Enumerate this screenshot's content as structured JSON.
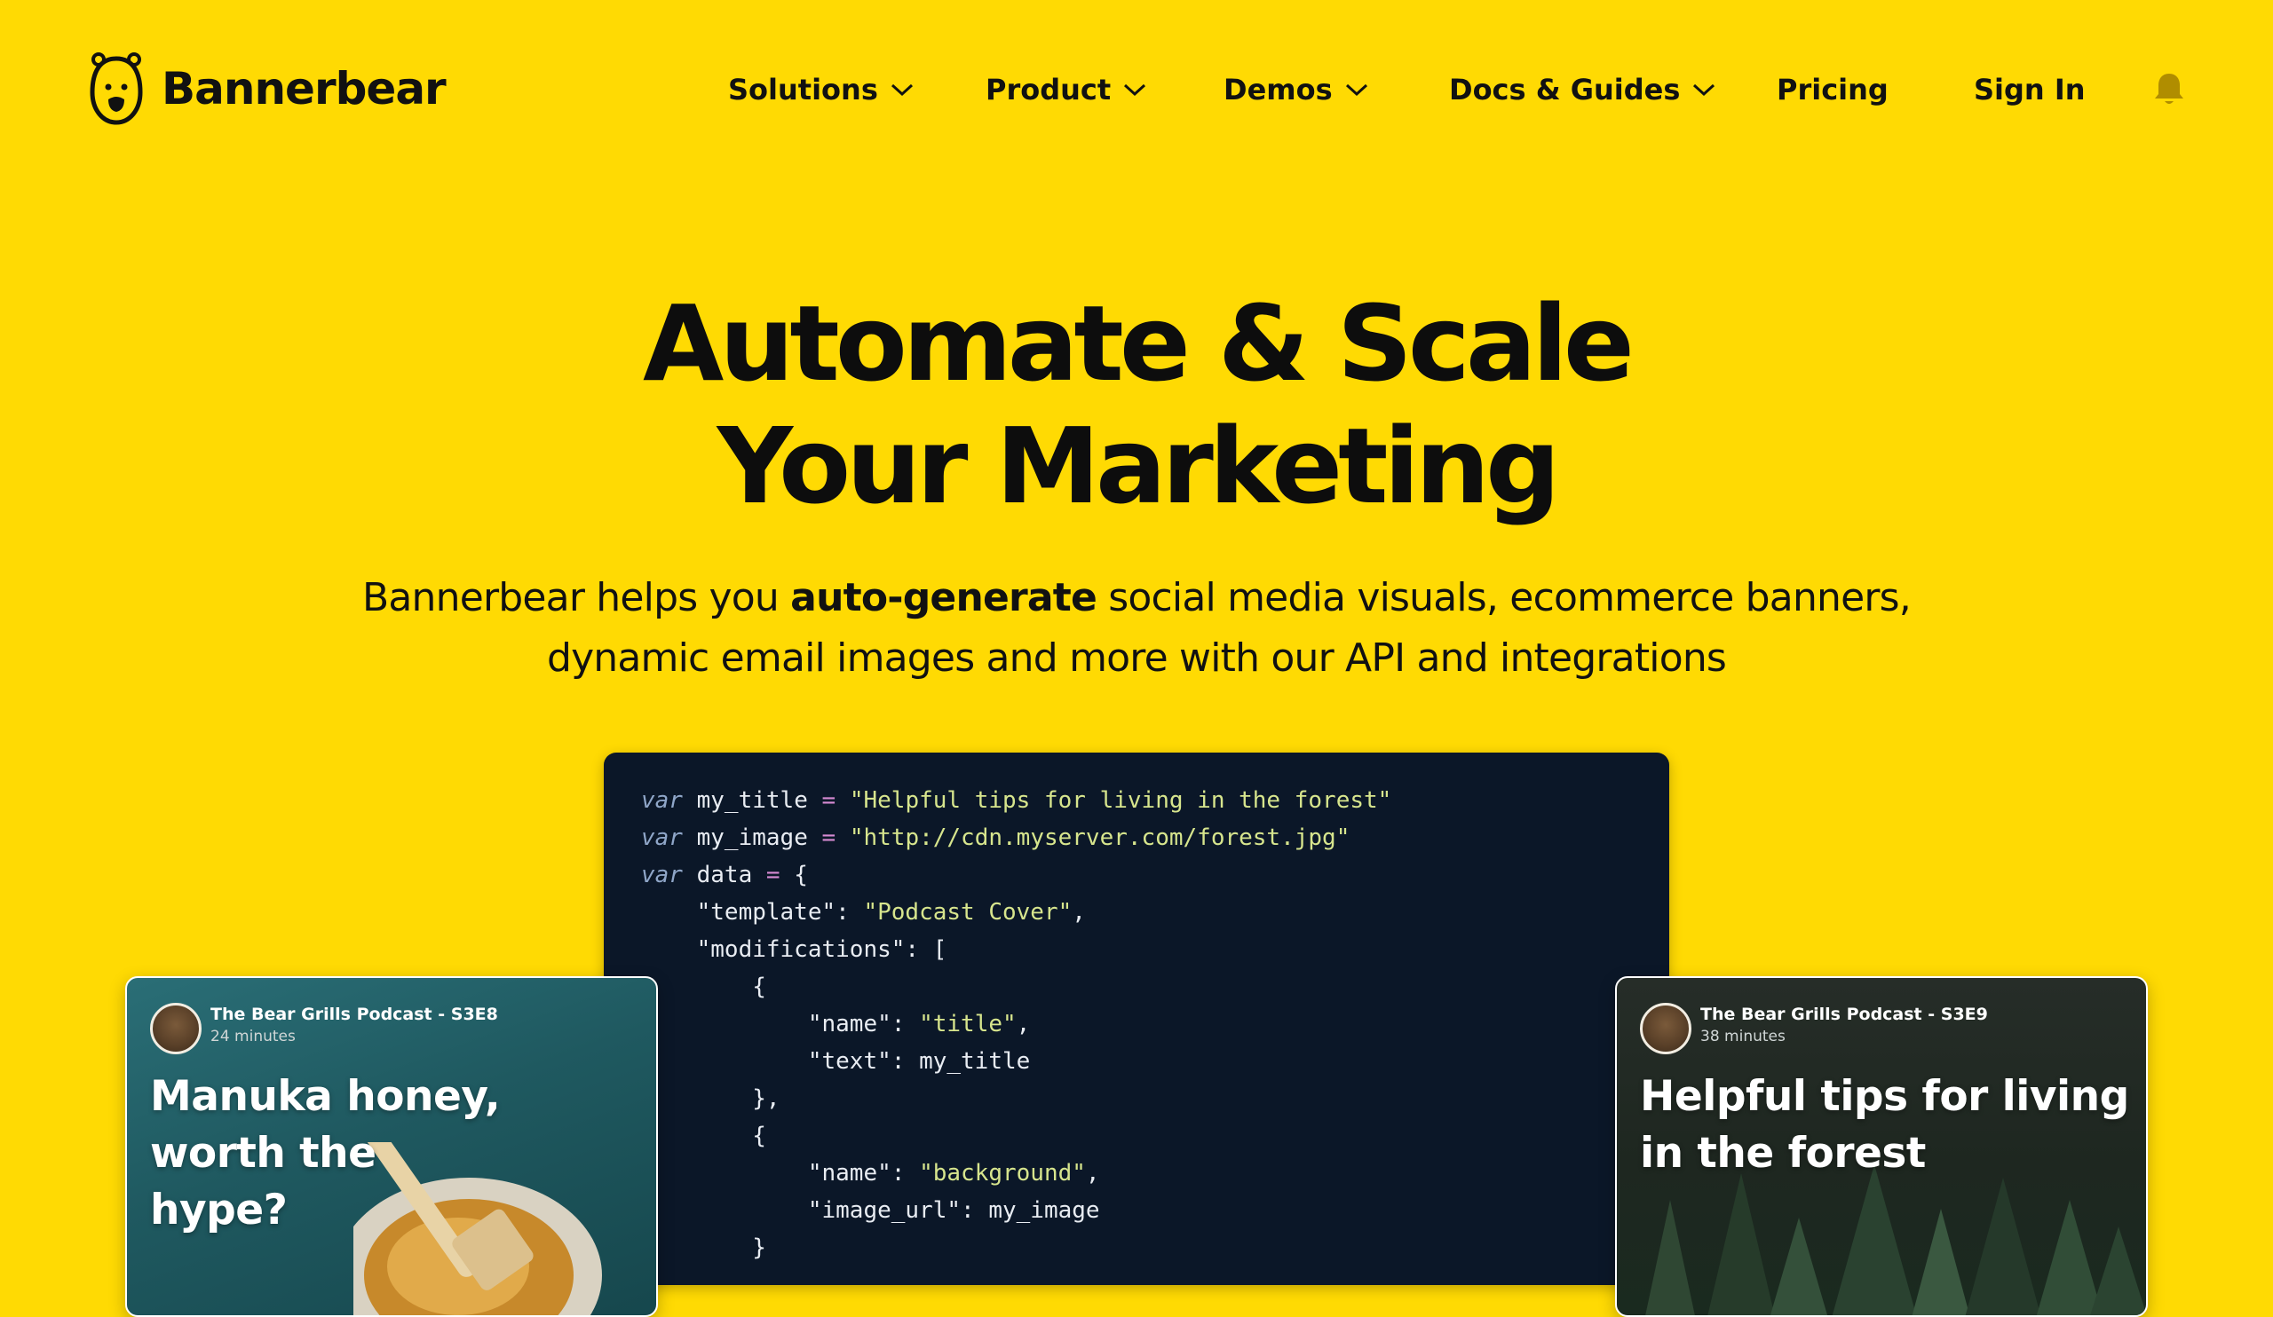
{
  "brand": {
    "name": "Bannerbear"
  },
  "nav": {
    "items": [
      {
        "label": "Solutions",
        "dropdown": true
      },
      {
        "label": "Product",
        "dropdown": true
      },
      {
        "label": "Demos",
        "dropdown": true
      },
      {
        "label": "Docs & Guides",
        "dropdown": true
      },
      {
        "label": "Pricing",
        "dropdown": false
      },
      {
        "label": "Sign In",
        "dropdown": false
      }
    ],
    "notification_icon": "bell-icon"
  },
  "hero": {
    "headline_line1": "Automate & Scale",
    "headline_line2": "Your Marketing",
    "sub_before": "Bannerbear helps you ",
    "sub_bold": "auto-generate",
    "sub_after_line1": " social media visuals, ecommerce banners,",
    "sub_line2": "dynamic email images and more with our API and integrations"
  },
  "code": {
    "lines": [
      "var my_title = \"Helpful tips for living in the forest\"",
      "var my_image = \"http://cdn.myserver.com/forest.jpg\"",
      "var data = {",
      "    \"template\": \"Podcast Cover\",",
      "    \"modifications\": [",
      "        {",
      "            \"name\": \"title\",",
      "            \"text\": my_title",
      "        },",
      "        {",
      "            \"name\": \"background\",",
      "            \"image_url\": my_image",
      "        }"
    ]
  },
  "cards": [
    {
      "show": "The Bear Grills Podcast - S3E8",
      "duration": "24 minutes",
      "title": "Manuka honey, worth the hype?"
    },
    {
      "show": "The Bear Grills Podcast - S3E9",
      "duration": "38 minutes",
      "title": "Helpful tips for living in the forest"
    }
  ],
  "colors": {
    "background": "#FFDA03",
    "code_bg": "#0b1728",
    "code_keyword": "#8fa6c8",
    "code_string": "#d7e58d",
    "code_operator": "#d78bd3"
  }
}
